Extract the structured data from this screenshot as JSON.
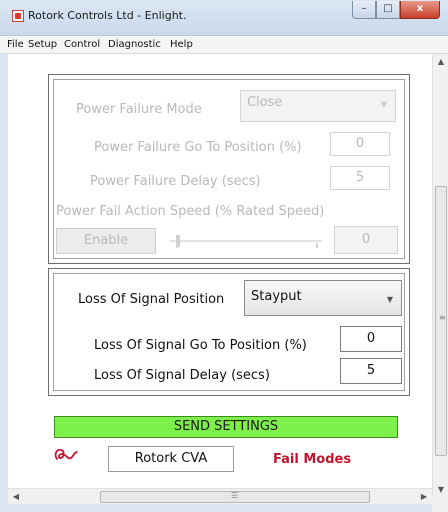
{
  "window": {
    "title": "Rotork Controls Ltd - Enlight.",
    "minimize_glyph": "–",
    "maximize_glyph": "□",
    "close_glyph": "x"
  },
  "menu": {
    "file": "File",
    "setup": "Setup",
    "control": "Control",
    "diagnostic": "Diagnostic",
    "help": "Help"
  },
  "power_failure": {
    "mode_label": "Power Failure Mode",
    "mode_value": "Close",
    "goto_label": "Power Failure Go To Position (%)",
    "goto_value": "0",
    "delay_label": "Power Failure Delay (secs)",
    "delay_value": "5",
    "speed_label": "Power Fail Action Speed (% Rated Speed)",
    "enable_label": "Enable",
    "speed_value": "0",
    "slider_level": 0.0
  },
  "loss_of_signal": {
    "position_label": "Loss Of Signal Position",
    "position_value": "Stayput",
    "goto_label": "Loss Of Signal Go To Position (%)",
    "goto_value": "0",
    "delay_label": "Loss Of Signal Delay (secs)",
    "delay_value": "5"
  },
  "footer": {
    "send_label": "SEND SETTINGS",
    "model": "Rotork CVA",
    "page_name": "Fail Modes"
  },
  "colors": {
    "send_button": "#7ef04a",
    "page_name": "#c4142c",
    "disabled_text": "#b9b9b9",
    "logo": "#c4142c"
  },
  "icons": {
    "app": "rotork-app-icon",
    "logo": "rotork-logo-icon",
    "dropdown": "chevron-down-icon"
  }
}
